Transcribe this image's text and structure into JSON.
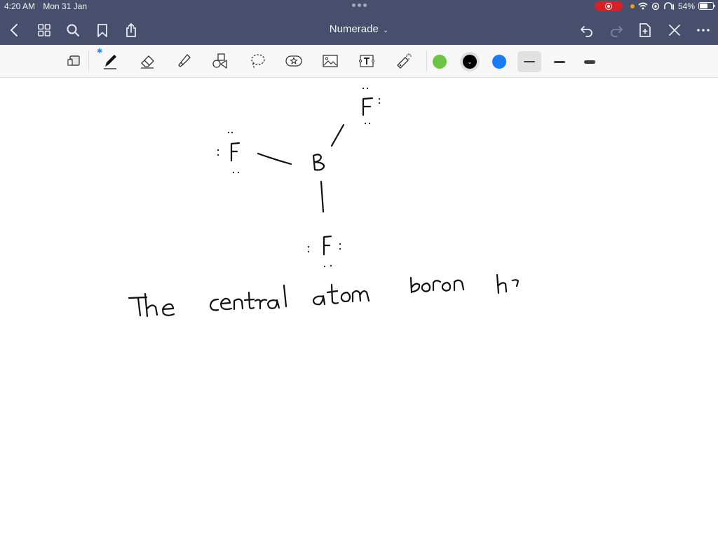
{
  "status_bar": {
    "time": "4:20 AM",
    "date": "Mon 31 Jan",
    "battery_percent": "54%",
    "battery_level": 0.54,
    "recording": true
  },
  "nav": {
    "title": "Numerade",
    "icons": {
      "back": "chevron-left-icon",
      "thumbnails": "grid-icon",
      "search": "search-icon",
      "bookmark": "bookmark-icon",
      "share": "share-icon",
      "undo": "undo-icon",
      "redo": "redo-icon",
      "add_page": "add-page-icon",
      "close": "close-icon",
      "more": "more-icon"
    }
  },
  "toolbar": {
    "tools": [
      "read-only-mode",
      "pen",
      "eraser",
      "highlighter",
      "shapes",
      "lasso",
      "sticker",
      "image",
      "text-box",
      "laser-pointer"
    ],
    "active_tool": "pen",
    "colors": [
      {
        "name": "green",
        "hex": "#6cc644"
      },
      {
        "name": "black",
        "hex": "#000000",
        "selected": true
      },
      {
        "name": "blue",
        "hex": "#1a7cf5"
      }
    ],
    "stroke_widths": [
      "thin",
      "medium",
      "thick"
    ],
    "active_stroke": "thin"
  },
  "canvas": {
    "handwriting": {
      "molecule": "BF3 Lewis structure",
      "central_atom": "B",
      "ligands": [
        "F",
        "F",
        "F"
      ],
      "sentence": "The central atom boron h"
    }
  }
}
